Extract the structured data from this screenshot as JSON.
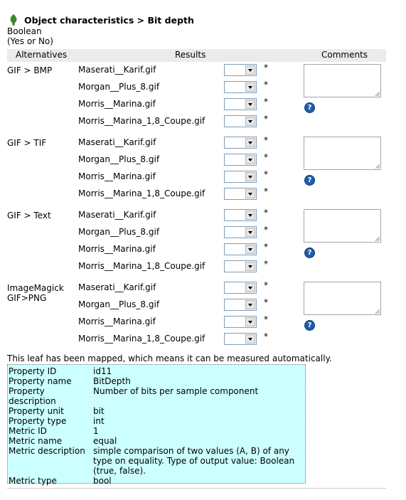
{
  "header": {
    "title": "Object characteristics > Bit depth",
    "scale_type": "Boolean",
    "scale_hint": "(Yes or No)"
  },
  "table": {
    "columns": [
      "Alternatives",
      "Results",
      "Comments"
    ],
    "groups": [
      {
        "alternative": "GIF > BMP",
        "files": [
          "Maserati__Karif.gif",
          "Morgan__Plus_8.gif",
          "Morris__Marina.gif",
          "Morris__Marina_1,8_Coupe.gif"
        ]
      },
      {
        "alternative": "GIF > TIF",
        "files": [
          "Maserati__Karif.gif",
          "Morgan__Plus_8.gif",
          "Morris__Marina.gif",
          "Morris__Marina_1,8_Coupe.gif"
        ]
      },
      {
        "alternative": "GIF > Text",
        "files": [
          "Maserati__Karif.gif",
          "Morgan__Plus_8.gif",
          "Morris__Marina.gif",
          "Morris__Marina_1,8_Coupe.gif"
        ]
      },
      {
        "alternative": "ImageMagick GIF>PNG",
        "files": [
          "Maserati__Karif.gif",
          "Morgan__Plus_8.gif",
          "Morris__Marina.gif",
          "Morris__Marina_1,8_Coupe.gif"
        ]
      }
    ],
    "required_mark": "*",
    "help_icon": "?"
  },
  "mapping": {
    "notice": "This leaf has been mapped, which means it can be measured automatically.",
    "properties": [
      {
        "label": "Property ID",
        "value": "id11"
      },
      {
        "label": "Property name",
        "value": "BitDepth"
      },
      {
        "label": "Property description",
        "value": "Number of bits per sample component"
      },
      {
        "label": "Property unit",
        "value": "bit"
      },
      {
        "label": "Property type",
        "value": "int"
      },
      {
        "label": "Metric ID",
        "value": "1"
      },
      {
        "label": "Metric name",
        "value": "equal"
      },
      {
        "label": "Metric description",
        "value": "simple comparison of two values (A, B) of any type on equality. Type of output value: Boolean (true, false)."
      },
      {
        "label": "Metric type",
        "value": "bool"
      }
    ]
  },
  "colors": {
    "leaf_icon": "#3a8a2a",
    "panel_bg": "#ccffff",
    "header_bg": "#ebebeb",
    "help_icon": "#1f5fa8"
  }
}
